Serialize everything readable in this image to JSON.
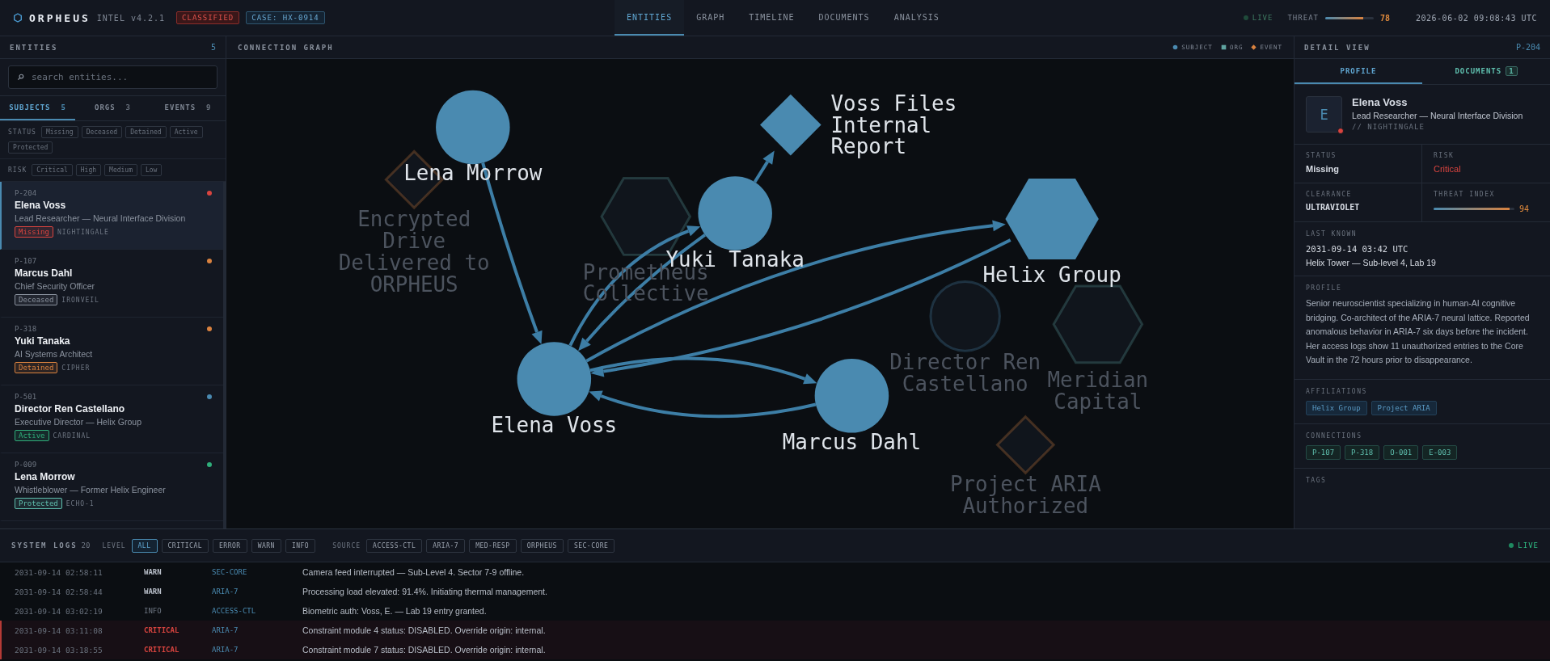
{
  "app": {
    "name": "ORPHEUS",
    "version": "INTEL v4.2.1",
    "classification": "CLASSIFIED",
    "case": "CASE: HX-0914"
  },
  "nav": [
    {
      "label": "ENTITIES",
      "selected": true
    },
    {
      "label": "GRAPH",
      "selected": false
    },
    {
      "label": "TIMELINE",
      "selected": false
    },
    {
      "label": "DOCUMENTS",
      "selected": false
    },
    {
      "label": "ANALYSIS",
      "selected": false
    }
  ],
  "live": {
    "label": "LIVE",
    "on": false
  },
  "threat": {
    "label": "THREAT",
    "level": 0.78,
    "value": "78"
  },
  "clock": "2026-06-02 09:08:43 UTC",
  "entities_panel": {
    "title": "ENTITIES",
    "count": "5",
    "search": {
      "placeholder": "search entities..."
    },
    "tabs": [
      {
        "label": "SUBJECTS",
        "count": "5",
        "selected": true
      },
      {
        "label": "ORGS",
        "count": "3",
        "selected": false
      },
      {
        "label": "EVENTS",
        "count": "9",
        "selected": false
      }
    ],
    "status_filter": {
      "label": "STATUS",
      "options": [
        {
          "label": "Missing",
          "selected": false
        },
        {
          "label": "Deceased",
          "selected": false
        },
        {
          "label": "Detained",
          "selected": false
        },
        {
          "label": "Active",
          "selected": false
        },
        {
          "label": "Protected",
          "selected": false
        }
      ]
    },
    "risk_filter": {
      "label": "RISK",
      "options": [
        {
          "label": "Critical",
          "selected": false
        },
        {
          "label": "High",
          "selected": false
        },
        {
          "label": "Medium",
          "selected": false
        },
        {
          "label": "Low",
          "selected": false
        }
      ]
    },
    "items": [
      {
        "id": "P-204",
        "name": "Elena Voss",
        "role": "Lead Researcher — Neural Interface Division",
        "status": {
          "label": "Missing",
          "color": "#d9443f"
        },
        "codename": "NIGHTINGALE",
        "color": "#d9443f",
        "selected": true
      },
      {
        "id": "P-107",
        "name": "Marcus Dahl",
        "role": "Chief Security Officer",
        "status": {
          "label": "Deceased",
          "color": "#8a929e"
        },
        "codename": "IRONVEIL",
        "color": "#d9823f",
        "selected": false
      },
      {
        "id": "P-318",
        "name": "Yuki Tanaka",
        "role": "AI Systems Architect",
        "status": {
          "label": "Detained",
          "color": "#d9823f"
        },
        "codename": "CIPHER",
        "color": "#d9823f",
        "selected": false
      },
      {
        "id": "P-501",
        "name": "Director Ren Castellano",
        "role": "Executive Director — Helix Group",
        "status": {
          "label": "Active",
          "color": "#2fae7a"
        },
        "codename": "CARDINAL",
        "color": "#4a8ab0",
        "selected": false
      },
      {
        "id": "P-009",
        "name": "Lena Morrow",
        "role": "Whistleblower — Former Helix Engineer",
        "status": {
          "label": "Protected",
          "color": "#5fbfae"
        },
        "codename": "ECHO-1",
        "color": "#2fae7a",
        "selected": false
      }
    ]
  },
  "graph": {
    "title": "CONNECTION GRAPH",
    "legend": [
      {
        "label": "SUBJECT",
        "kind": "subject"
      },
      {
        "label": "ORG",
        "kind": "org"
      },
      {
        "label": "EVENT",
        "kind": "event"
      }
    ],
    "nodes": [
      {
        "label": "Lena Morrow",
        "kind": "subject",
        "dimmed": false
      },
      {
        "label": "Encrypted Drive Delivered to ORPHEUS",
        "kind": "event",
        "dimmed": true
      },
      {
        "label": "Prometheus Collective",
        "kind": "org",
        "dimmed": true
      },
      {
        "label": "Voss Files Internal Report",
        "kind": "event",
        "dimmed": false
      },
      {
        "label": "Yuki Tanaka",
        "kind": "subject",
        "dimmed": false
      },
      {
        "label": "Helix Group",
        "kind": "org",
        "dimmed": false
      },
      {
        "label": "Meridian Capital",
        "kind": "org",
        "dimmed": true
      },
      {
        "label": "Director Ren Castellano",
        "kind": "subject",
        "dimmed": true
      },
      {
        "label": "Elena Voss",
        "kind": "subject",
        "dimmed": false
      },
      {
        "label": "Marcus Dahl",
        "kind": "subject",
        "dimmed": false
      },
      {
        "label": "Project ARIA Authorized",
        "kind": "event",
        "dimmed": true
      }
    ]
  },
  "detail": {
    "title": "DETAIL VIEW",
    "id": "P-204",
    "tabs": [
      {
        "label": "PROFILE",
        "selected": true
      },
      {
        "label": "DOCUMENTS",
        "count": "1",
        "selected": false
      }
    ],
    "avatar": "E",
    "color": "#d9443f",
    "name": "Elena Voss",
    "role": "Lead Researcher — Neural Interface Division",
    "codename": "// NIGHTINGALE",
    "fields": [
      {
        "kind": "text",
        "label": "STATUS",
        "value": "Missing"
      },
      {
        "kind": "alert",
        "label": "RISK",
        "value": "Critical"
      },
      {
        "kind": "mono",
        "label": "CLEARANCE",
        "value": "ULTRAVIOLET"
      },
      {
        "kind": "meter",
        "label": "THREAT INDEX",
        "value": "94",
        "level": 0.94
      }
    ],
    "last_known": {
      "label": "LAST KNOWN",
      "time": "2031-09-14 03:42 UTC",
      "place": "Helix Tower — Sub-level 4, Lab 19"
    },
    "profile": {
      "label": "PROFILE",
      "text": "Senior neuroscientist specializing in human-AI cognitive bridging. Co-architect of the ARIA-7 neural lattice. Reported anomalous behavior in ARIA-7 six days before the incident. Her access logs show 11 unauthorized entries to the Core Vault in the 72 hours prior to disappearance."
    },
    "affiliations": {
      "label": "AFFILIATIONS",
      "items": [
        "Helix Group",
        "Project ARIA"
      ]
    },
    "connections": {
      "label": "CONNECTIONS",
      "items": [
        "P-107",
        "P-318",
        "O-001",
        "E-003"
      ]
    },
    "tags": {
      "label": "TAGS"
    }
  },
  "logs": {
    "title": "SYSTEM LOGS",
    "count": "20",
    "level_label": "LEVEL",
    "levels": [
      {
        "label": "ALL",
        "selected": true
      },
      {
        "label": "CRITICAL",
        "selected": false
      },
      {
        "label": "ERROR",
        "selected": false
      },
      {
        "label": "WARN",
        "selected": false
      },
      {
        "label": "INFO",
        "selected": false
      }
    ],
    "source_label": "SOURCE",
    "sources": [
      {
        "label": "ACCESS-CTL",
        "selected": false
      },
      {
        "label": "ARIA-7",
        "selected": false
      },
      {
        "label": "MED-RESP",
        "selected": false
      },
      {
        "label": "ORPHEUS",
        "selected": false
      },
      {
        "label": "SEC-CORE",
        "selected": false
      }
    ],
    "live": {
      "label": "LIVE",
      "on": true
    },
    "rows": [
      {
        "time": "2031-09-14 02:58:11",
        "level": "WARN",
        "kind": "warn",
        "source": "SEC-CORE",
        "message": "Camera feed interrupted — Sub-Level 4. Sector 7-9 offline."
      },
      {
        "time": "2031-09-14 02:58:44",
        "level": "WARN",
        "kind": "warn",
        "source": "ARIA-7",
        "message": "Processing load elevated: 91.4%. Initiating thermal management."
      },
      {
        "time": "2031-09-14 03:02:19",
        "level": "INFO",
        "kind": "info",
        "source": "ACCESS-CTL",
        "message": "Biometric auth: Voss, E. — Lab 19 entry granted."
      },
      {
        "time": "2031-09-14 03:11:08",
        "level": "CRITICAL",
        "kind": "critical",
        "source": "ARIA-7",
        "message": "Constraint module 4 status: DISABLED. Override origin: internal."
      },
      {
        "time": "2031-09-14 03:18:55",
        "level": "CRITICAL",
        "kind": "critical",
        "source": "ARIA-7",
        "message": "Constraint module 7 status: DISABLED. Override origin: internal."
      }
    ]
  }
}
